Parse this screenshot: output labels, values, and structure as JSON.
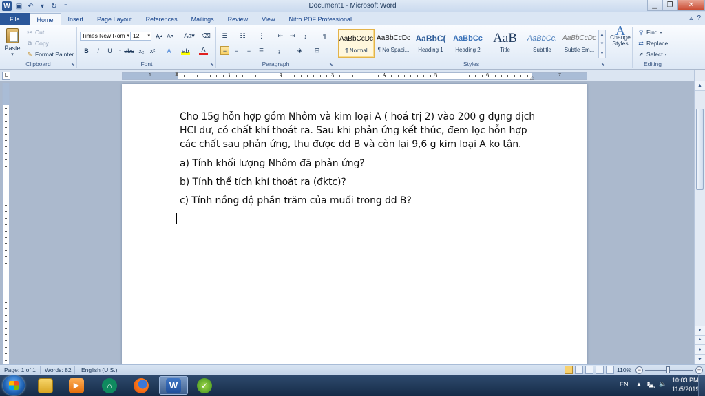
{
  "window": {
    "title": "Document1 - Microsoft Word",
    "logo_letter": "W"
  },
  "tabs": [
    "File",
    "Home",
    "Insert",
    "Page Layout",
    "References",
    "Mailings",
    "Review",
    "View",
    "Nitro PDF Professional"
  ],
  "ribbon": {
    "clipboard": {
      "label": "Clipboard",
      "paste": "Paste",
      "cut": "Cut",
      "copy": "Copy",
      "format_painter": "Format Painter"
    },
    "font": {
      "label": "Font",
      "font_name": "Times New Rom",
      "font_size": "12",
      "bold": "B",
      "italic": "I",
      "underline": "U"
    },
    "paragraph": {
      "label": "Paragraph"
    },
    "styles": {
      "label": "Styles",
      "items": [
        {
          "preview": "AaBbCcDc",
          "name": "¶ Normal"
        },
        {
          "preview": "AaBbCcDc",
          "name": "¶ No Spaci..."
        },
        {
          "preview": "AaBbC(",
          "name": "Heading 1"
        },
        {
          "preview": "AaBbCc",
          "name": "Heading 2"
        },
        {
          "preview": "AaB",
          "name": "Title"
        },
        {
          "preview": "AaBbCc.",
          "name": "Subtitle"
        },
        {
          "preview": "AaBbCcDc",
          "name": "Subtle Em..."
        }
      ],
      "change_styles": "Change Styles"
    },
    "editing": {
      "label": "Editing",
      "find": "Find",
      "replace": "Replace",
      "select": "Select"
    }
  },
  "ruler_numbers": [
    "1",
    "1",
    "2",
    "3",
    "4",
    "5",
    "6",
    "7"
  ],
  "document": {
    "paragraphs": [
      "Cho 15g hỗn hợp gồm Nhôm và kim loại A ( hoá trị 2) vào 200 g dụng dịch HCl dư, có chất khí thoát ra. Sau khi phản ứng kết thúc, đem lọc hỗn hợp các chất sau phản ứng, thu được dd B và còn lại 9,6 g kim loại A ko tận.",
      "a) Tính khối lượng Nhôm đã phản ứng?",
      "b) Tính thể tích khí thoát ra (đktc)?",
      "c) Tính nồng độ phần trăm của muối trong dd B?"
    ]
  },
  "status": {
    "page": "Page: 1 of 1",
    "words": "Words: 82",
    "language": "English (U.S.)",
    "zoom": "110%"
  },
  "taskbar": {
    "lang": "EN",
    "time": "10:03 PM",
    "date": "11/5/2019"
  },
  "colors": {
    "file_tab": "#2b579a",
    "ribbon_text": "#1e395b",
    "selected_style": "#fff7dd"
  }
}
